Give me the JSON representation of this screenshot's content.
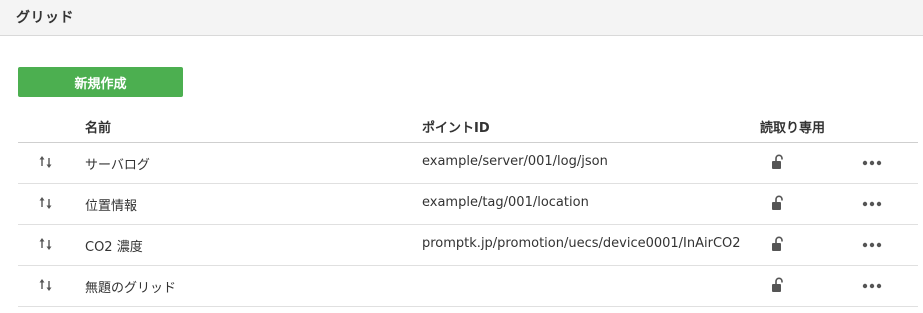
{
  "header": {
    "title": "グリッド"
  },
  "toolbar": {
    "create_label": "新規作成",
    "create_color": "#4caf50"
  },
  "table": {
    "columns": {
      "name": "名前",
      "point_id": "ポイントID",
      "read_only": "読取り専用"
    },
    "rows": [
      {
        "name": "サーバログ",
        "point_id": "example/server/001/log/json",
        "read_only_icon": "unlocked-lock-icon",
        "menu_icon": "more-dots-icon",
        "sort_icon": "sort-arrows-icon"
      },
      {
        "name": "位置情報",
        "point_id": "example/tag/001/location",
        "read_only_icon": "unlocked-lock-icon",
        "menu_icon": "more-dots-icon",
        "sort_icon": "sort-arrows-icon"
      },
      {
        "name": "CO2 濃度",
        "point_id": "promptk.jp/promotion/uecs/device0001/InAirCO2",
        "read_only_icon": "unlocked-lock-icon",
        "menu_icon": "more-dots-icon",
        "sort_icon": "sort-arrows-icon"
      },
      {
        "name": "無題のグリッド",
        "point_id": "",
        "read_only_icon": "unlocked-lock-icon",
        "menu_icon": "more-dots-icon",
        "sort_icon": "sort-arrows-icon"
      }
    ]
  }
}
